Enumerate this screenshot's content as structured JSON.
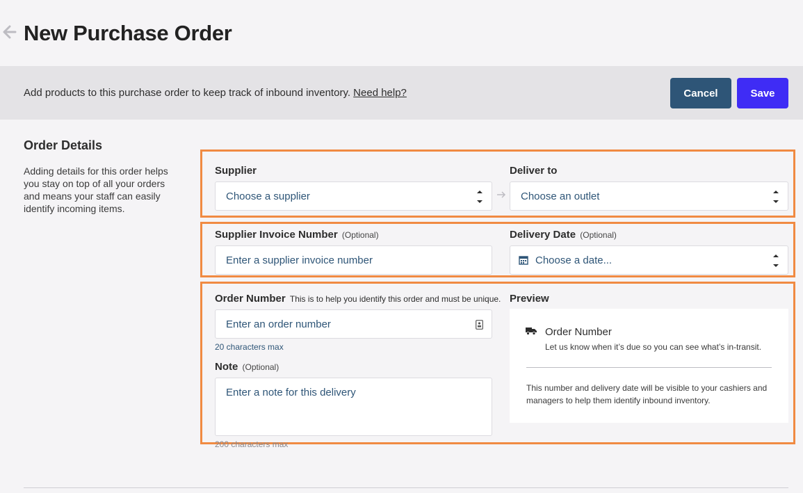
{
  "page": {
    "title": "New Purchase Order"
  },
  "banner": {
    "text": "Add products to this purchase order to keep track of inbound inventory.",
    "help_link": "Need help?",
    "cancel_label": "Cancel",
    "save_label": "Save"
  },
  "section": {
    "title": "Order Details",
    "description": "Adding details for this order helps you stay on top of all your orders and means your staff can easily identify incoming items."
  },
  "form": {
    "supplier": {
      "label": "Supplier",
      "value": "Choose a supplier"
    },
    "deliver_to": {
      "label": "Deliver to",
      "value": "Choose an outlet"
    },
    "invoice_number": {
      "label": "Supplier Invoice Number",
      "optional": "(Optional)",
      "placeholder": "Enter a supplier invoice number"
    },
    "delivery_date": {
      "label": "Delivery Date",
      "optional": "(Optional)",
      "placeholder": "Choose a date..."
    },
    "order_number": {
      "label": "Order Number",
      "helper": "This is to help you identify this order and must be unique.",
      "placeholder": "Enter an order number",
      "hint": "20 characters max"
    },
    "note": {
      "label": "Note",
      "optional": "(Optional)",
      "placeholder": "Enter a note for this delivery",
      "hint": "200 characters max"
    }
  },
  "preview": {
    "label": "Preview",
    "title": "Order Number",
    "subtitle": "Let us know when it’s due so you can see what’s in-transit.",
    "info": "This number and delivery date will be visible to your cashiers and managers to help them identify inbound inventory."
  },
  "colors": {
    "accent": "#3f2cf5",
    "cancel": "#2e5577",
    "highlight": "#f08a42",
    "link_text": "#2e5577"
  },
  "icons": [
    "back-arrow-icon",
    "stepper-icon",
    "arrow-right-icon",
    "calendar-icon",
    "id-card-icon",
    "truck-icon"
  ]
}
